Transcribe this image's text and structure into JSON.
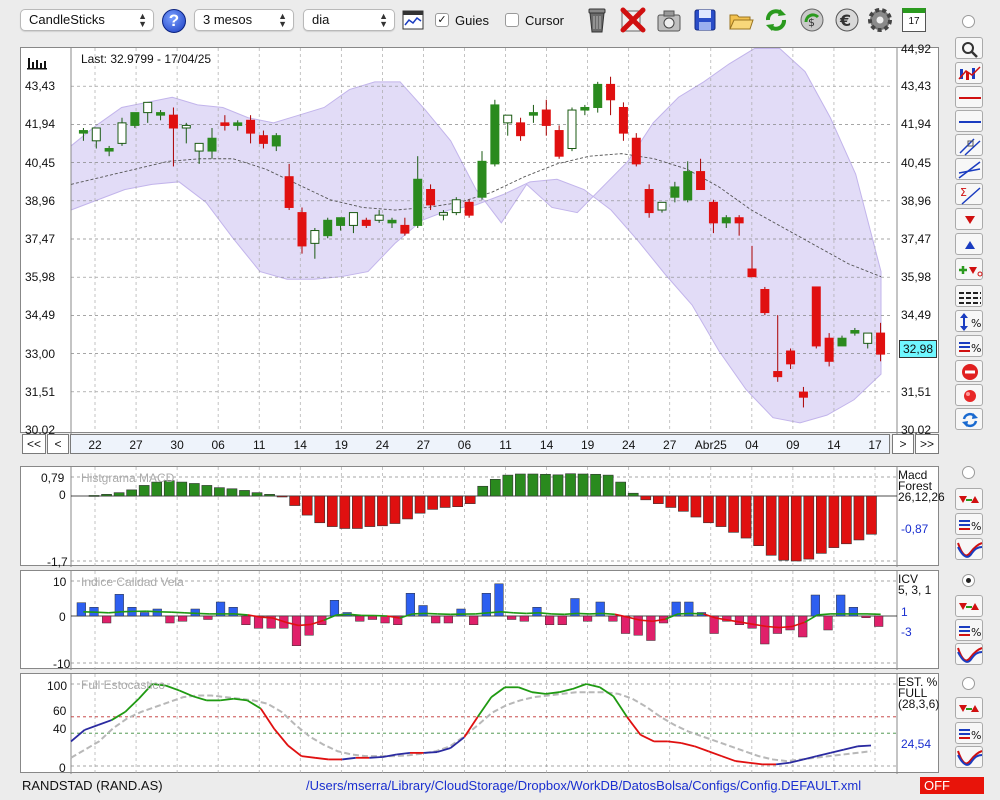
{
  "toolbar": {
    "chart_type": "CandleSticks",
    "period": "3 mesos",
    "interval": "dia",
    "guides_label": "Guies",
    "guides_checked": true,
    "cursor_label": "Cursor",
    "cursor_checked": false,
    "help_glyph": "?",
    "calendar_glyph": "17",
    "icons": [
      "chart-window-icon",
      "trash-icon",
      "delete-x-icon",
      "camera-icon",
      "save-icon",
      "open-folder-icon",
      "refresh-icon",
      "money-icon",
      "euro-icon",
      "settings-gear-icon",
      "calendar-icon"
    ]
  },
  "main_panel": {
    "last_label": "Last: 32.9799 - 17/04/25",
    "price_tag": "32,98",
    "left_ticks": [
      "43,43",
      "41,94",
      "40,45",
      "38,96",
      "37,47",
      "35,98",
      "34,49",
      "33,00",
      "31,51",
      "30,02"
    ],
    "right_ticks": [
      "43,43",
      "41,94",
      "40,45",
      "38,96",
      "37,47",
      "35,98",
      "34,49",
      "31,51",
      "30,02"
    ],
    "top_cut_label": "44,92"
  },
  "navigation": {
    "first": "<<",
    "prev": "<",
    "next": ">",
    "last": ">>",
    "dates": [
      "22",
      "27",
      "30",
      "06",
      "11",
      "14",
      "19",
      "24",
      "27",
      "06",
      "11",
      "14",
      "19",
      "24",
      "27",
      "Abr25",
      "04",
      "09",
      "14",
      "17"
    ]
  },
  "macd_panel": {
    "title": "Histgrama MACD",
    "ticks": [
      "0,79",
      "0",
      "-1,7"
    ],
    "info": [
      "Macd",
      "Forest",
      "26,12,26"
    ],
    "value": "-0,87"
  },
  "icv_panel": {
    "title": "Indice Calidad Vela",
    "ticks": [
      "10",
      "0",
      "-10"
    ],
    "info": [
      "ICV",
      "5, 3, 1"
    ],
    "value_a": "1",
    "value_b": "-3"
  },
  "stoch_panel": {
    "title": "Full Estocastico",
    "ticks": [
      "100",
      "60",
      "40",
      "0"
    ],
    "info": [
      "EST. %",
      "FULL",
      "(28,3,6)"
    ],
    "value": "24,54"
  },
  "status": {
    "symbol": "RANDSTAD (RAND.AS)",
    "path": "/Users/mserra/Library/CloudStorage/Dropbox/WorkDB/DatosBolsa/Configs/Config.DEFAULT.xml",
    "off_label": "OFF"
  },
  "colors": {
    "up": "#2a8a1e",
    "down": "#e01010",
    "band": "#ddd6f6",
    "macd_pos": "#2a8a1e",
    "macd_neg": "#e01010",
    "icv_pos": "#2d5ff0",
    "icv_neg": "#e0206a",
    "stoch_green": "#1f9a12",
    "stoch_red": "#e01010",
    "stoch_blue": "#2a2aa0"
  },
  "chart_data": {
    "type": "candlestick",
    "ylim": [
      30.02,
      44.92
    ],
    "candles": [
      {
        "o": 41.6,
        "h": 41.8,
        "l": 41.3,
        "c": 41.7
      },
      {
        "o": 41.3,
        "h": 41.8,
        "l": 41.0,
        "c": 41.8
      },
      {
        "o": 40.9,
        "h": 41.1,
        "l": 40.7,
        "c": 41.0
      },
      {
        "o": 41.2,
        "h": 42.2,
        "l": 41.1,
        "c": 42.0
      },
      {
        "o": 41.9,
        "h": 42.4,
        "l": 41.8,
        "c": 42.4
      },
      {
        "o": 42.4,
        "h": 42.8,
        "l": 42.0,
        "c": 42.8
      },
      {
        "o": 42.3,
        "h": 42.5,
        "l": 42.1,
        "c": 42.4
      },
      {
        "o": 42.3,
        "h": 42.6,
        "l": 40.3,
        "c": 41.8
      },
      {
        "o": 41.8,
        "h": 42.0,
        "l": 41.2,
        "c": 41.9
      },
      {
        "o": 40.9,
        "h": 41.1,
        "l": 40.4,
        "c": 41.2
      },
      {
        "o": 40.9,
        "h": 41.8,
        "l": 40.6,
        "c": 41.4
      },
      {
        "o": 42.0,
        "h": 42.3,
        "l": 41.7,
        "c": 41.9
      },
      {
        "o": 41.9,
        "h": 42.1,
        "l": 41.7,
        "c": 42.0
      },
      {
        "o": 42.1,
        "h": 42.3,
        "l": 41.2,
        "c": 41.6
      },
      {
        "o": 41.5,
        "h": 41.7,
        "l": 41.0,
        "c": 41.2
      },
      {
        "o": 41.1,
        "h": 41.6,
        "l": 40.9,
        "c": 41.5
      },
      {
        "o": 39.9,
        "h": 40.4,
        "l": 38.6,
        "c": 38.7
      },
      {
        "o": 38.5,
        "h": 38.7,
        "l": 36.9,
        "c": 37.2
      },
      {
        "o": 37.3,
        "h": 37.9,
        "l": 36.7,
        "c": 37.8
      },
      {
        "o": 37.6,
        "h": 38.3,
        "l": 37.5,
        "c": 38.2
      },
      {
        "o": 38.0,
        "h": 38.3,
        "l": 37.8,
        "c": 38.3
      },
      {
        "o": 38.0,
        "h": 38.5,
        "l": 37.7,
        "c": 38.5
      },
      {
        "o": 38.2,
        "h": 38.3,
        "l": 37.9,
        "c": 38.0
      },
      {
        "o": 38.2,
        "h": 38.6,
        "l": 38.1,
        "c": 38.4
      },
      {
        "o": 38.1,
        "h": 38.3,
        "l": 37.9,
        "c": 38.2
      },
      {
        "o": 38.0,
        "h": 38.3,
        "l": 37.6,
        "c": 37.7
      },
      {
        "o": 38.0,
        "h": 40.7,
        "l": 37.9,
        "c": 39.8
      },
      {
        "o": 39.4,
        "h": 39.6,
        "l": 38.6,
        "c": 38.8
      },
      {
        "o": 38.4,
        "h": 38.6,
        "l": 38.2,
        "c": 38.5
      },
      {
        "o": 38.5,
        "h": 39.1,
        "l": 38.4,
        "c": 39.0
      },
      {
        "o": 38.9,
        "h": 39.0,
        "l": 38.3,
        "c": 38.4
      },
      {
        "o": 39.1,
        "h": 40.9,
        "l": 39.0,
        "c": 40.5
      },
      {
        "o": 40.4,
        "h": 42.9,
        "l": 40.3,
        "c": 42.7
      },
      {
        "o": 42.0,
        "h": 42.3,
        "l": 41.5,
        "c": 42.3
      },
      {
        "o": 42.0,
        "h": 42.2,
        "l": 41.3,
        "c": 41.5
      },
      {
        "o": 42.3,
        "h": 42.7,
        "l": 42.0,
        "c": 42.4
      },
      {
        "o": 42.5,
        "h": 42.9,
        "l": 41.5,
        "c": 41.9
      },
      {
        "o": 41.7,
        "h": 41.9,
        "l": 40.6,
        "c": 40.7
      },
      {
        "o": 41.0,
        "h": 42.6,
        "l": 40.9,
        "c": 42.5
      },
      {
        "o": 42.5,
        "h": 42.7,
        "l": 42.3,
        "c": 42.6
      },
      {
        "o": 42.6,
        "h": 43.6,
        "l": 42.4,
        "c": 43.5
      },
      {
        "o": 43.5,
        "h": 43.8,
        "l": 42.3,
        "c": 42.9
      },
      {
        "o": 42.6,
        "h": 42.8,
        "l": 41.3,
        "c": 41.6
      },
      {
        "o": 41.4,
        "h": 41.6,
        "l": 40.3,
        "c": 40.4
      },
      {
        "o": 39.4,
        "h": 39.6,
        "l": 38.3,
        "c": 38.5
      },
      {
        "o": 38.6,
        "h": 38.9,
        "l": 38.5,
        "c": 38.9
      },
      {
        "o": 39.1,
        "h": 39.7,
        "l": 38.9,
        "c": 39.5
      },
      {
        "o": 39.0,
        "h": 40.5,
        "l": 38.9,
        "c": 40.1
      },
      {
        "o": 40.1,
        "h": 40.6,
        "l": 39.4,
        "c": 39.4
      },
      {
        "o": 38.9,
        "h": 39.0,
        "l": 37.7,
        "c": 38.1
      },
      {
        "o": 38.1,
        "h": 38.4,
        "l": 37.9,
        "c": 38.3
      },
      {
        "o": 38.3,
        "h": 38.4,
        "l": 37.6,
        "c": 38.1
      },
      {
        "o": 36.3,
        "h": 37.2,
        "l": 36.1,
        "c": 36.0
      },
      {
        "o": 35.5,
        "h": 35.6,
        "l": 34.5,
        "c": 34.6
      },
      {
        "o": 32.3,
        "h": 34.5,
        "l": 31.9,
        "c": 32.1
      },
      {
        "o": 33.1,
        "h": 33.2,
        "l": 32.4,
        "c": 32.6
      },
      {
        "o": 31.5,
        "h": 31.7,
        "l": 30.9,
        "c": 31.3
      },
      {
        "o": 35.6,
        "h": 35.6,
        "l": 33.2,
        "c": 33.3
      },
      {
        "o": 33.6,
        "h": 33.8,
        "l": 32.5,
        "c": 32.7
      },
      {
        "o": 33.3,
        "h": 33.7,
        "l": 33.3,
        "c": 33.6
      },
      {
        "o": 33.8,
        "h": 34.0,
        "l": 33.7,
        "c": 33.9
      },
      {
        "o": 33.4,
        "h": 33.8,
        "l": 33.2,
        "c": 33.8
      },
      {
        "o": 33.8,
        "h": 34.2,
        "l": 32.7,
        "c": 32.98
      }
    ],
    "band_upper": [
      41.1,
      41.9,
      42.6,
      42.8,
      43.0,
      42.7,
      42.6,
      42.2,
      42.0,
      42.3,
      42.6,
      43.3,
      43.6,
      43.6,
      42.5,
      41.3,
      39.4,
      38.1
    ],
    "band_lower": [
      38.6,
      39.0,
      39.4,
      39.6,
      39.7,
      38.9,
      37.5,
      36.2,
      35.9,
      35.9,
      36.0,
      36.2,
      37.3,
      38.2,
      38.6,
      38.8,
      39.2,
      39.7,
      39.8,
      39.4,
      38.6,
      37.4,
      36.1,
      34.9,
      33.1,
      31.6,
      30.5,
      30.3,
      30.6,
      31.2,
      32.2
    ],
    "ma_line": [
      39.6,
      39.9,
      40.2,
      40.5,
      40.6,
      40.6,
      40.2,
      39.6,
      39.0,
      38.7,
      38.6,
      38.7,
      38.9,
      39.3,
      39.9,
      40.4,
      40.7,
      40.8,
      40.6,
      40.2,
      39.5,
      38.6,
      37.9,
      37.2,
      36.5,
      36.0
    ],
    "macd_hist": [
      0.02,
      0.06,
      0.12,
      0.22,
      0.38,
      0.5,
      0.55,
      0.5,
      0.45,
      0.38,
      0.3,
      0.26,
      0.2,
      0.12,
      0.06,
      -0.02,
      -0.25,
      -0.5,
      -0.7,
      -0.8,
      -0.85,
      -0.85,
      -0.8,
      -0.78,
      -0.72,
      -0.6,
      -0.45,
      -0.35,
      -0.3,
      -0.28,
      -0.2,
      0.35,
      0.6,
      0.75,
      0.79,
      0.79,
      0.78,
      0.76,
      0.8,
      0.79,
      0.78,
      0.75,
      0.5,
      0.1,
      -0.1,
      -0.2,
      -0.3,
      -0.4,
      -0.55,
      -0.7,
      -0.8,
      -0.95,
      -1.1,
      -1.3,
      -1.55,
      -1.68,
      -1.7,
      -1.65,
      -1.5,
      -1.35,
      -1.25,
      -1.15,
      -1.0
    ],
    "icv_bars": [
      3.8,
      2.5,
      -2.0,
      6.2,
      2.5,
      1.0,
      2.0,
      -2.0,
      -1.5,
      2.0,
      -1.0,
      4.0,
      2.5,
      -2.5,
      -3.5,
      -3.5,
      -3.5,
      -8.5,
      -5.5,
      -2.5,
      4.5,
      1.0,
      -1.5,
      -1.0,
      -2.0,
      -2.5,
      6.5,
      3.0,
      -2.0,
      -2.0,
      2.0,
      -2.5,
      6.5,
      9.2,
      -1.0,
      -1.5,
      2.5,
      -2.5,
      -2.5,
      5.0,
      -1.5,
      4.0,
      -1.5,
      -5.0,
      -5.5,
      -7.0,
      -2.0,
      4.0,
      4.0,
      1.0,
      -5.0,
      -1.5,
      -2.5,
      -3.5,
      -8.0,
      -5.0,
      -4.0,
      -6.0,
      6.0,
      -4.0,
      6.0,
      2.5,
      -0.5,
      -3.0
    ],
    "icv_line": [
      2.0,
      1.8,
      1.5,
      2.0,
      2.2,
      2.3,
      2.0,
      1.8,
      1.5,
      1.2,
      1.0,
      1.0,
      1.0,
      0.5,
      -0.5,
      -1.0,
      -3.0,
      -4.5,
      -4.0,
      -2.0,
      0.5,
      0.8,
      0.3,
      0.2,
      0.0,
      -1.0,
      1.0,
      1.2,
      1.0,
      0.8,
      0.9,
      1.0,
      1.5,
      2.0,
      1.5,
      1.2,
      1.5,
      1.0,
      0.8,
      1.2,
      1.0,
      1.2,
      0.8,
      -0.5,
      -2.0,
      -2.5,
      -1.5,
      1.0,
      1.2,
      1.0,
      -1.0,
      -2.0,
      -3.0,
      -4.0,
      -5.0,
      -5.5,
      -5.0,
      -3.0,
      0.5,
      1.0,
      1.0,
      1.0,
      1.0,
      0.8
    ],
    "stoch_k": [
      30,
      44,
      50,
      56,
      66,
      82,
      100,
      98,
      92,
      85,
      80,
      80,
      82,
      80,
      70,
      45,
      25,
      12,
      10,
      8,
      8,
      10,
      10,
      11,
      14,
      16,
      16,
      17,
      22,
      35,
      60,
      84,
      96,
      96,
      90,
      88,
      90,
      94,
      100,
      96,
      85,
      60,
      38,
      30,
      30,
      28,
      24,
      18,
      12,
      6,
      4,
      2,
      2,
      4,
      8,
      12,
      16,
      20,
      24,
      25
    ],
    "stoch_d": [
      10,
      20,
      30,
      46,
      58,
      66,
      72,
      78,
      84,
      86,
      86,
      84,
      82,
      80,
      76,
      66,
      50,
      36,
      26,
      18,
      14,
      12,
      12,
      12,
      13,
      15,
      18,
      24,
      36,
      50,
      65,
      74,
      80,
      84,
      86,
      88,
      90,
      90,
      90,
      88,
      82,
      72,
      60,
      50,
      42,
      36,
      30,
      24,
      18,
      12,
      8,
      6,
      8,
      10,
      12,
      14,
      16,
      18
    ]
  }
}
